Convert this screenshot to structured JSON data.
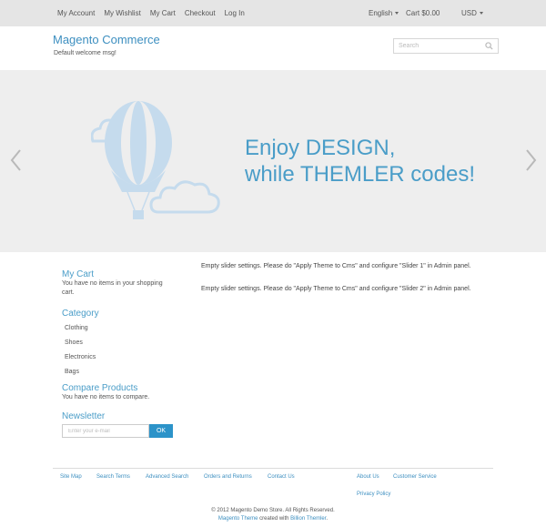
{
  "topbar": {
    "links": [
      "My Account",
      "My Wishlist",
      "My Cart",
      "Checkout",
      "Log In"
    ],
    "language": "English",
    "cart": "Cart $0.00",
    "currency": "USD"
  },
  "header": {
    "logo": "Magento Commerce",
    "welcome": "Default welcome msg!",
    "search_placeholder": "Search"
  },
  "slider": {
    "headline_line1": "Enjoy DESIGN,",
    "headline_line2": "while THEMLER codes!"
  },
  "sidebar": {
    "cart_title": "My Cart",
    "cart_text": "You have no items in your shopping cart.",
    "category_title": "Category",
    "categories": [
      "Clothing",
      "Shoes",
      "Electronics",
      "Bags"
    ],
    "compare_title": "Compare Products",
    "compare_text": "You have no items to compare.",
    "newsletter_title": "Newsletter",
    "newsletter_placeholder": "Enter your e-mail",
    "newsletter_button": "OK"
  },
  "main": {
    "message1": "Empty slider settings. Please do \"Apply Theme to Cms\" and configure \"Slider 1\" in Admin panel.",
    "message2": "Empty slider settings. Please do \"Apply Theme to Cms\" and configure \"Slider 2\" in Admin panel."
  },
  "footer": {
    "links": [
      "Site Map",
      "Search Terms",
      "Advanced Search",
      "Orders and Returns",
      "Contact Us"
    ],
    "about": "About Us",
    "customer_service": "Customer Service",
    "privacy": "Privacy Policy",
    "copyright": "© 2012 Magento Demo Store. All Rights Reserved.",
    "credit_theme": "Magento Theme",
    "credit_middle": " created with ",
    "credit_tool": "Billion Themler",
    "credit_end": "."
  },
  "colors": {
    "accent": "#4a9dc8",
    "button": "#2c93c9",
    "topbar_bg": "#e5e5e5",
    "slider_bg": "#eeeeee",
    "balloon": "#c5dbed"
  }
}
